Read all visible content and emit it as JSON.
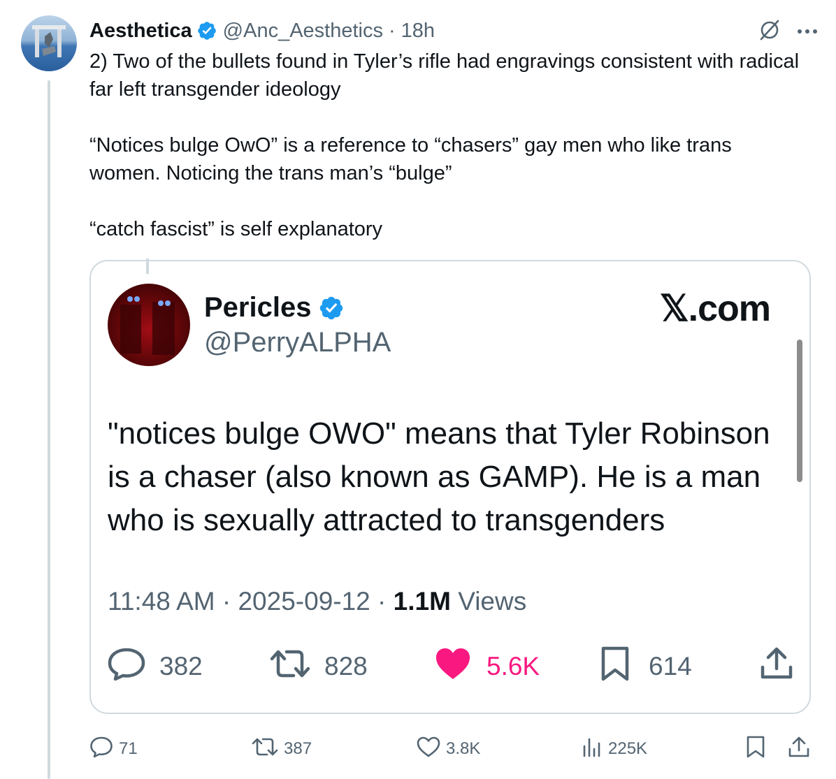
{
  "tweet": {
    "author_name": "Aesthetica",
    "handle": "@Anc_Aesthetics",
    "separator": "·",
    "time": "18h",
    "text": "2) Two of the bullets found in Tyler’s rifle had engravings consistent with radical far left transgender ideology\n\n“Notices bulge OwO” is a reference to “chasers” gay men who like trans women. Noticing the trans man’s “bulge”\n\n“catch fascist” is self explanatory"
  },
  "quote": {
    "author_name": "Pericles",
    "handle": "@PerryALPHA",
    "brand": "𝕏.com",
    "text": "\"notices bulge OWO\" means that Tyler Robinson is a chaser (also known as GAMP). He is a man who is sexually attracted to transgenders",
    "time": "11:48 AM",
    "sep1": "·",
    "date": "2025-09-12",
    "sep2": "·",
    "views_count": "1.1M",
    "views_label": "Views",
    "replies": "382",
    "reposts": "828",
    "likes": "5.6K",
    "bookmarks": "614"
  },
  "actions": {
    "replies": "71",
    "reposts": "387",
    "likes": "3.8K",
    "views": "225K"
  },
  "colors": {
    "verified": "#1d9bf0",
    "text_primary": "#0f1419",
    "text_secondary": "#536471",
    "like_active": "#f91880",
    "border": "#cfd9de"
  },
  "icons": [
    "verified-badge-icon",
    "grok-icon",
    "more-icon",
    "reply-icon",
    "repost-icon",
    "like-icon",
    "bookmark-icon",
    "share-icon",
    "views-icon"
  ]
}
